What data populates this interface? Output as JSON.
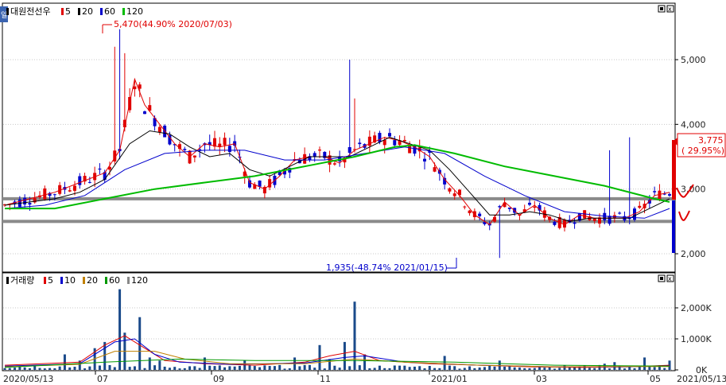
{
  "side_tab": "일",
  "price_panel": {
    "legend": [
      {
        "text": "대원전선우",
        "color": "#000000"
      },
      {
        "text": "5",
        "color": "#e00000"
      },
      {
        "text": "20",
        "color": "#000000"
      },
      {
        "text": "60",
        "color": "#0000cc"
      },
      {
        "text": "120",
        "color": "#00bb00"
      }
    ],
    "high_annotation": "5,470(44.90% 2020/07/03)",
    "low_annotation": "1,935(-48.74% 2021/01/15)",
    "current_price": "3,775",
    "current_change": "( 29.95%)"
  },
  "volume_panel": {
    "legend": [
      {
        "text": "거래량",
        "color": "#000000"
      },
      {
        "text": "5",
        "color": "#e00000"
      },
      {
        "text": "10",
        "color": "#0000cc"
      },
      {
        "text": "20",
        "color": "#c08000"
      },
      {
        "text": "60",
        "color": "#009900"
      },
      {
        "text": "120",
        "color": "#888888"
      }
    ]
  },
  "x_axis_labels": [
    "2020/05/13",
    "07",
    "09",
    "11",
    "2021/01",
    "03",
    "05",
    "2021/05/13"
  ],
  "chart_data": [
    {
      "type": "candlestick",
      "title": "대원전선우",
      "y_ticks": [
        "5,000",
        "4,000",
        "3,000",
        "2,000"
      ],
      "y_values": [
        5000,
        4000,
        3000,
        2000
      ],
      "ylim": [
        1800,
        5600
      ],
      "x_range": [
        "2020/05/13",
        "2021/05/13"
      ],
      "support_lines": [
        2850,
        2500
      ],
      "series": [
        {
          "name": "5",
          "color": "#e00000",
          "values": [
            [
              0,
              2750
            ],
            [
              5,
              2850
            ],
            [
              10,
              2950
            ],
            [
              15,
              3100
            ],
            [
              20,
              3250
            ],
            [
              23,
              3600
            ],
            [
              26,
              4700
            ],
            [
              28,
              4300
            ],
            [
              31,
              4000
            ],
            [
              34,
              3700
            ],
            [
              37,
              3500
            ],
            [
              40,
              3700
            ],
            [
              43,
              3650
            ],
            [
              46,
              3700
            ],
            [
              49,
              3100
            ],
            [
              52,
              3000
            ],
            [
              55,
              3200
            ],
            [
              58,
              3450
            ],
            [
              61,
              3500
            ],
            [
              64,
              3500
            ],
            [
              67,
              3400
            ],
            [
              70,
              3600
            ],
            [
              73,
              3700
            ],
            [
              76,
              3800
            ],
            [
              79,
              3750
            ],
            [
              82,
              3650
            ],
            [
              85,
              3500
            ],
            [
              88,
              3150
            ],
            [
              91,
              2900
            ],
            [
              94,
              2600
            ],
            [
              97,
              2450
            ],
            [
              100,
              2800
            ],
            [
              103,
              2600
            ],
            [
              106,
              2750
            ],
            [
              109,
              2550
            ],
            [
              112,
              2450
            ],
            [
              115,
              2600
            ],
            [
              118,
              2550
            ],
            [
              121,
              2550
            ],
            [
              124,
              2550
            ],
            [
              127,
              2650
            ],
            [
              130,
              2900
            ],
            [
              133,
              2950
            ]
          ]
        },
        {
          "name": "20",
          "color": "#000000",
          "values": [
            [
              0,
              2750
            ],
            [
              5,
              2800
            ],
            [
              10,
              2850
            ],
            [
              15,
              2950
            ],
            [
              20,
              3150
            ],
            [
              25,
              3700
            ],
            [
              29,
              3900
            ],
            [
              33,
              3850
            ],
            [
              37,
              3650
            ],
            [
              41,
              3500
            ],
            [
              45,
              3550
            ],
            [
              49,
              3300
            ],
            [
              53,
              3200
            ],
            [
              57,
              3350
            ],
            [
              61,
              3500
            ],
            [
              65,
              3500
            ],
            [
              69,
              3500
            ],
            [
              73,
              3650
            ],
            [
              77,
              3800
            ],
            [
              81,
              3700
            ],
            [
              85,
              3600
            ],
            [
              89,
              3300
            ],
            [
              93,
              2950
            ],
            [
              97,
              2600
            ],
            [
              101,
              2600
            ],
            [
              105,
              2650
            ],
            [
              109,
              2600
            ],
            [
              113,
              2500
            ],
            [
              117,
              2550
            ],
            [
              121,
              2550
            ],
            [
              125,
              2550
            ],
            [
              129,
              2700
            ],
            [
              133,
              2850
            ]
          ]
        },
        {
          "name": "60",
          "color": "#0000cc",
          "values": [
            [
              0,
              2700
            ],
            [
              8,
              2750
            ],
            [
              16,
              2900
            ],
            [
              24,
              3300
            ],
            [
              32,
              3550
            ],
            [
              40,
              3600
            ],
            [
              48,
              3600
            ],
            [
              56,
              3450
            ],
            [
              64,
              3450
            ],
            [
              72,
              3550
            ],
            [
              80,
              3650
            ],
            [
              88,
              3550
            ],
            [
              96,
              3200
            ],
            [
              104,
              2900
            ],
            [
              112,
              2650
            ],
            [
              120,
              2580
            ],
            [
              128,
              2550
            ],
            [
              133,
              2700
            ]
          ]
        },
        {
          "name": "120",
          "color": "#00bb00",
          "values": [
            [
              0,
              2700
            ],
            [
              10,
              2700
            ],
            [
              20,
              2850
            ],
            [
              30,
              3000
            ],
            [
              40,
              3100
            ],
            [
              50,
              3200
            ],
            [
              60,
              3350
            ],
            [
              70,
              3500
            ],
            [
              78,
              3650
            ],
            [
              82,
              3680
            ],
            [
              90,
              3550
            ],
            [
              100,
              3350
            ],
            [
              110,
              3200
            ],
            [
              120,
              3050
            ],
            [
              130,
              2850
            ],
            [
              133,
              2800
            ]
          ]
        }
      ]
    },
    {
      "type": "bar",
      "title": "거래량",
      "y_ticks": [
        "2,000K",
        "1,000K",
        "0K"
      ],
      "y_values": [
        2000,
        1000,
        0
      ],
      "ylim": [
        0,
        2800
      ],
      "unit": "K",
      "series": [
        {
          "name": "volume",
          "color": "#1a4a8a",
          "values": [
            [
              12,
              500
            ],
            [
              15,
              300
            ],
            [
              18,
              700
            ],
            [
              20,
              900
            ],
            [
              23,
              2600
            ],
            [
              24,
              1200
            ],
            [
              27,
              1700
            ],
            [
              29,
              400
            ],
            [
              31,
              300
            ],
            [
              40,
              400
            ],
            [
              48,
              300
            ],
            [
              58,
              400
            ],
            [
              63,
              800
            ],
            [
              65,
              350
            ],
            [
              68,
              900
            ],
            [
              70,
              2200
            ],
            [
              72,
              500
            ],
            [
              88,
              450
            ],
            [
              99,
              300
            ],
            [
              120,
              200
            ],
            [
              122,
              250
            ],
            [
              128,
              400
            ],
            [
              133,
              300
            ]
          ]
        },
        {
          "name": "5",
          "color": "#e00000",
          "values": [
            [
              0,
              150
            ],
            [
              15,
              250
            ],
            [
              20,
              800
            ],
            [
              24,
              1100
            ],
            [
              28,
              700
            ],
            [
              32,
              300
            ],
            [
              40,
              200
            ],
            [
              50,
              150
            ],
            [
              60,
              250
            ],
            [
              65,
              450
            ],
            [
              70,
              600
            ],
            [
              75,
              300
            ],
            [
              85,
              200
            ],
            [
              95,
              150
            ],
            [
              105,
              100
            ],
            [
              115,
              80
            ],
            [
              125,
              100
            ],
            [
              133,
              150
            ]
          ]
        },
        {
          "name": "10",
          "color": "#0000cc",
          "values": [
            [
              0,
              120
            ],
            [
              15,
              200
            ],
            [
              22,
              900
            ],
            [
              26,
              1000
            ],
            [
              30,
              500
            ],
            [
              35,
              250
            ],
            [
              45,
              180
            ],
            [
              60,
              220
            ],
            [
              68,
              400
            ],
            [
              72,
              450
            ],
            [
              80,
              250
            ],
            [
              95,
              150
            ],
            [
              110,
              100
            ],
            [
              125,
              100
            ],
            [
              133,
              130
            ]
          ]
        },
        {
          "name": "20",
          "color": "#c08000",
          "values": [
            [
              0,
              100
            ],
            [
              15,
              180
            ],
            [
              22,
              600
            ],
            [
              30,
              600
            ],
            [
              36,
              350
            ],
            [
              45,
              200
            ],
            [
              60,
              200
            ],
            [
              70,
              350
            ],
            [
              80,
              250
            ],
            [
              95,
              150
            ],
            [
              110,
              100
            ],
            [
              133,
              110
            ]
          ]
        },
        {
          "name": "60",
          "color": "#009900",
          "values": [
            [
              0,
              80
            ],
            [
              20,
              250
            ],
            [
              35,
              350
            ],
            [
              50,
              300
            ],
            [
              70,
              300
            ],
            [
              90,
              250
            ],
            [
              110,
              150
            ],
            [
              133,
              120
            ]
          ]
        }
      ]
    }
  ]
}
